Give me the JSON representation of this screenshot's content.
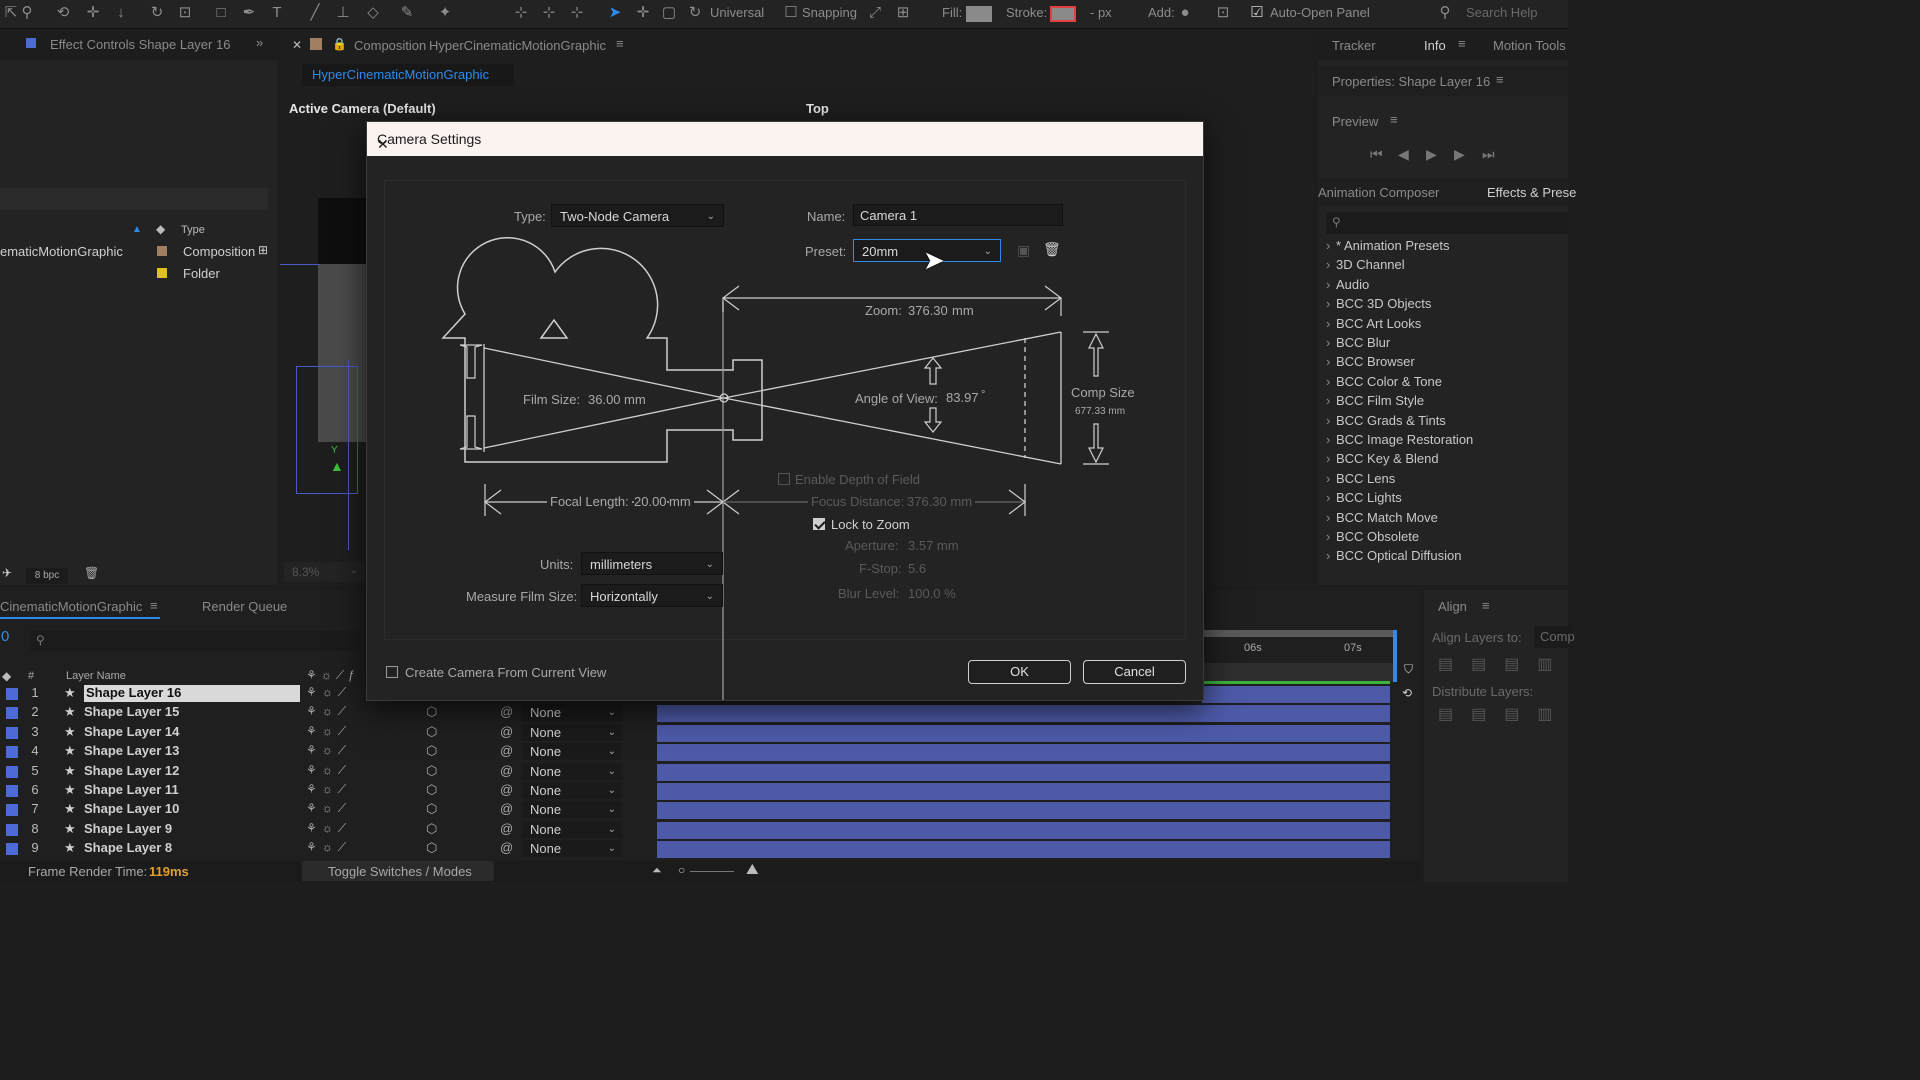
{
  "toolbar": {
    "universal_label": "Universal",
    "snapping_label": "Snapping",
    "fill_label": "Fill:",
    "stroke_label": "Stroke:",
    "stroke_unit": "- px",
    "add_label": "Add:",
    "auto_open_label": "Auto-Open Panel",
    "search_placeholder": "Search Help"
  },
  "left_panel": {
    "tab_label": "Effect Controls Shape Layer 16",
    "type_header": "Type",
    "items": [
      {
        "name": "ematicMotionGraphic",
        "type": "Composition"
      },
      {
        "name": "",
        "type": "Folder"
      }
    ],
    "bpc_label": "8 bpc"
  },
  "composition": {
    "tab_label": "Composition",
    "comp_name": "HyperCinematicMotionGraphic",
    "sub_tab": "HyperCinematicMotionGraphic",
    "view_left": "Active Camera (Default)",
    "view_right": "Top",
    "zoom_value": "8.3%"
  },
  "right_panel": {
    "tabs": [
      "Tracker",
      "Info",
      "Motion Tools"
    ],
    "properties_label": "Properties: Shape Layer 16",
    "preview_label": "Preview",
    "animation_composer_label": "Animation Composer",
    "effects_label": "Effects & Prese",
    "effects_list": [
      "* Animation Presets",
      "3D Channel",
      "Audio",
      "BCC 3D Objects",
      "BCC Art Looks",
      "BCC Blur",
      "BCC Browser",
      "BCC Color & Tone",
      "BCC Film Style",
      "BCC Grads & Tints",
      "BCC Image Restoration",
      "BCC Key & Blend",
      "BCC Lens",
      "BCC Lights",
      "BCC Match Move",
      "BCC Obsolete",
      "BCC Optical Diffusion"
    ],
    "align_label": "Align",
    "align_layers_to": "Align Layers to:",
    "align_target": "Comp",
    "distribute_label": "Distribute Layers:"
  },
  "timeline": {
    "tab_label": "CinematicMotionGraphic",
    "render_queue_label": "Render Queue",
    "timecode": "0",
    "col_hash": "#",
    "col_layer_name": "Layer Name",
    "ruler": [
      "06s",
      "07s"
    ],
    "layers": [
      {
        "num": "1",
        "name": "Shape Layer 16",
        "parent": "None"
      },
      {
        "num": "2",
        "name": "Shape Layer 15",
        "parent": "None"
      },
      {
        "num": "3",
        "name": "Shape Layer 14",
        "parent": "None"
      },
      {
        "num": "4",
        "name": "Shape Layer 13",
        "parent": "None"
      },
      {
        "num": "5",
        "name": "Shape Layer 12",
        "parent": "None"
      },
      {
        "num": "6",
        "name": "Shape Layer 11",
        "parent": "None"
      },
      {
        "num": "7",
        "name": "Shape Layer 10",
        "parent": "None"
      },
      {
        "num": "8",
        "name": "Shape Layer 9",
        "parent": "None"
      },
      {
        "num": "9",
        "name": "Shape Layer 8",
        "parent": "None"
      }
    ],
    "frame_render_label": "Frame Render Time:",
    "frame_render_value": "119ms",
    "toggle_label": "Toggle Switches / Modes"
  },
  "dialog": {
    "title": "Camera Settings",
    "type_label": "Type:",
    "type_value": "Two-Node Camera",
    "name_label": "Name:",
    "name_value": "Camera 1",
    "preset_label": "Preset:",
    "preset_value": "20mm",
    "zoom_label": "Zoom:",
    "zoom_value": "376.30",
    "zoom_unit": "mm",
    "film_size_label": "Film Size:",
    "film_size_value": "36.00",
    "film_size_unit": "mm",
    "angle_label": "Angle of View:",
    "angle_value": "83.97",
    "angle_unit": "°",
    "comp_size_label": "Comp Size",
    "comp_size_value": "677.33 mm",
    "enable_dof_label": "Enable Depth of Field",
    "focal_length_label": "Focal Length:",
    "focal_length_value": "20.00",
    "focal_length_unit": "mm",
    "focus_distance_label": "Focus Distance:",
    "focus_distance_value": "376.30 mm",
    "lock_to_zoom_label": "Lock to Zoom",
    "aperture_label": "Aperture:",
    "aperture_value": "3.57 mm",
    "fstop_label": "F-Stop:",
    "fstop_value": "5.6",
    "blur_label": "Blur Level:",
    "blur_value": "100.0 %",
    "units_label": "Units:",
    "units_value": "millimeters",
    "measure_label": "Measure Film Size:",
    "measure_value": "Horizontally",
    "create_from_view_label": "Create Camera From Current View",
    "ok_label": "OK",
    "cancel_label": "Cancel"
  }
}
